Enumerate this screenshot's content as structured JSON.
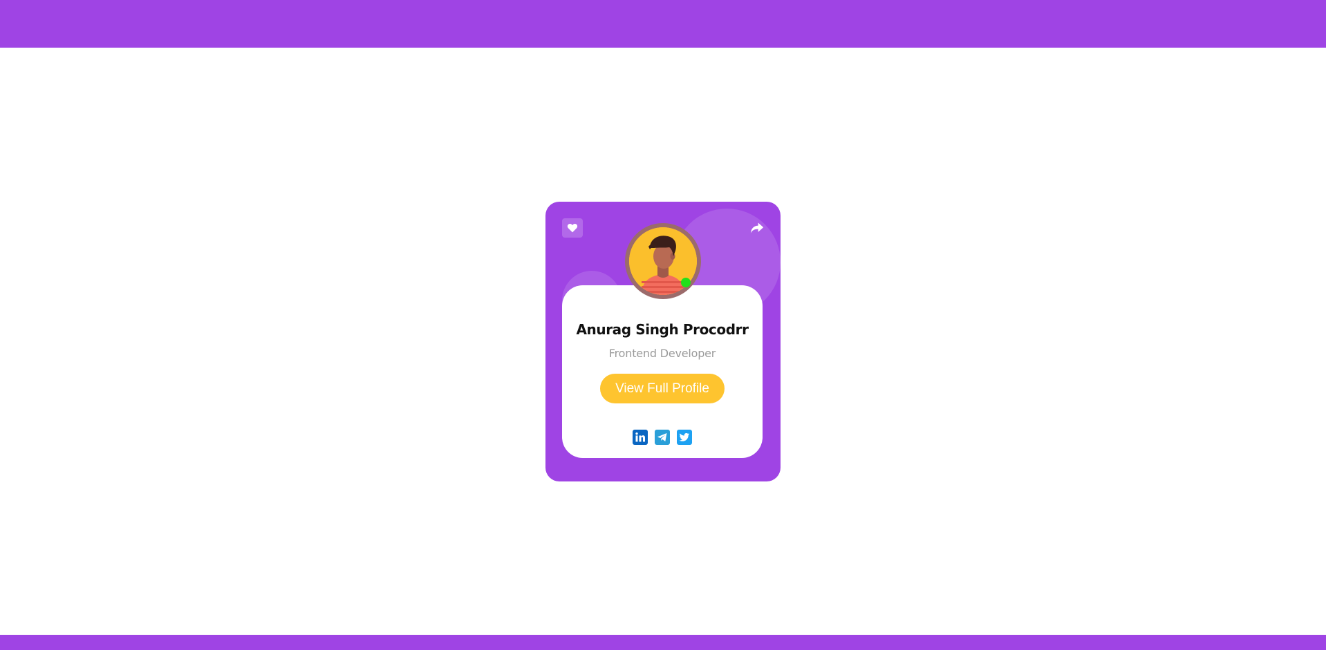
{
  "profile": {
    "name": "Anurag Singh Procodrr",
    "role": "Frontend Developer",
    "button_label": "View Full Profile",
    "status": "online"
  },
  "actions": {
    "like_icon": "heart-icon",
    "share_icon": "share-icon"
  },
  "socials": [
    {
      "name": "linkedin",
      "icon": "linkedin-icon",
      "color": "#0a66c2"
    },
    {
      "name": "telegram",
      "icon": "telegram-icon",
      "color": "#2a9fd8"
    },
    {
      "name": "twitter",
      "icon": "twitter-icon",
      "color": "#1da1f2"
    }
  ],
  "colors": {
    "brand": "#9f44e4",
    "button": "#fec42f",
    "online": "#22e01a",
    "card_inner": "#ffffff"
  }
}
